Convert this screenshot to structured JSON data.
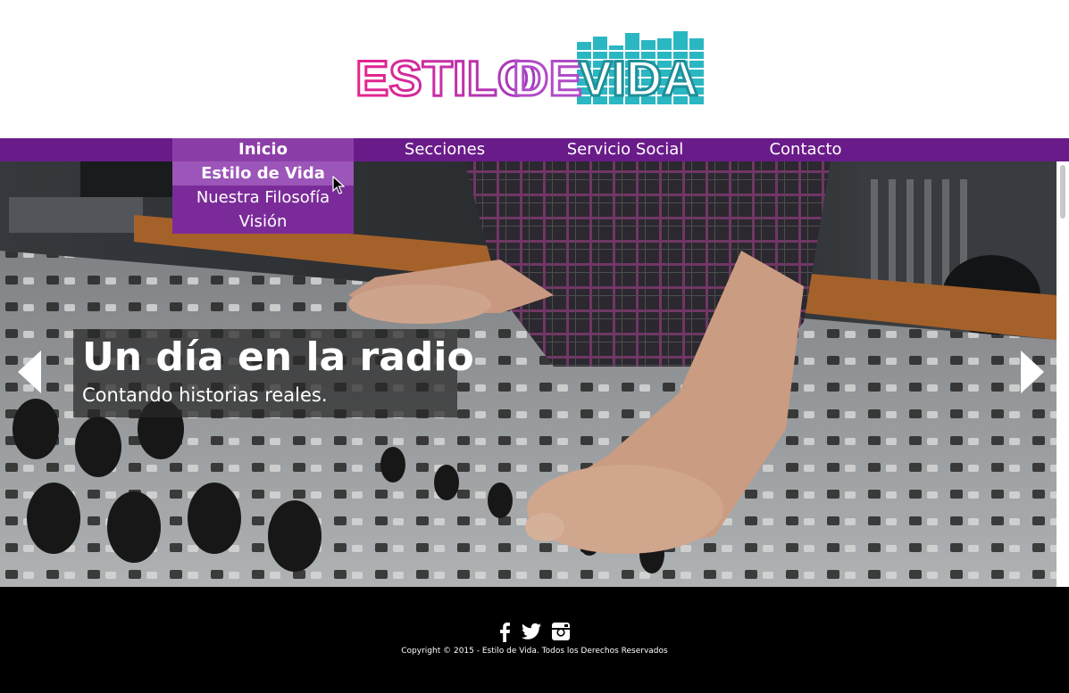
{
  "logo": {
    "part1": "ESTILO",
    "part2": "DE",
    "part3": "VIDA"
  },
  "nav": {
    "items": [
      {
        "label": "Inicio"
      },
      {
        "label": "Secciones"
      },
      {
        "label": "Servicio Social"
      },
      {
        "label": "Contacto"
      }
    ],
    "dropdown": [
      {
        "label": "Estilo de Vida"
      },
      {
        "label": "Nuestra Filosofía"
      },
      {
        "label": "Visión"
      }
    ]
  },
  "hero": {
    "title": "Un día en la radio",
    "subtitle": "Contando historias reales."
  },
  "footer": {
    "social": [
      "facebook-icon",
      "twitter-icon",
      "instagram-icon"
    ],
    "copyright": "Copyright © 2015 - Estilo de Vida. Todos los Derechos Reservados"
  },
  "colors": {
    "nav_bg": "#6a1b8a",
    "nav_active": "#8c3ea8",
    "logo_pink": "#e8238c",
    "logo_purple": "#9b3bb8",
    "logo_teal": "#2ab7c2"
  }
}
